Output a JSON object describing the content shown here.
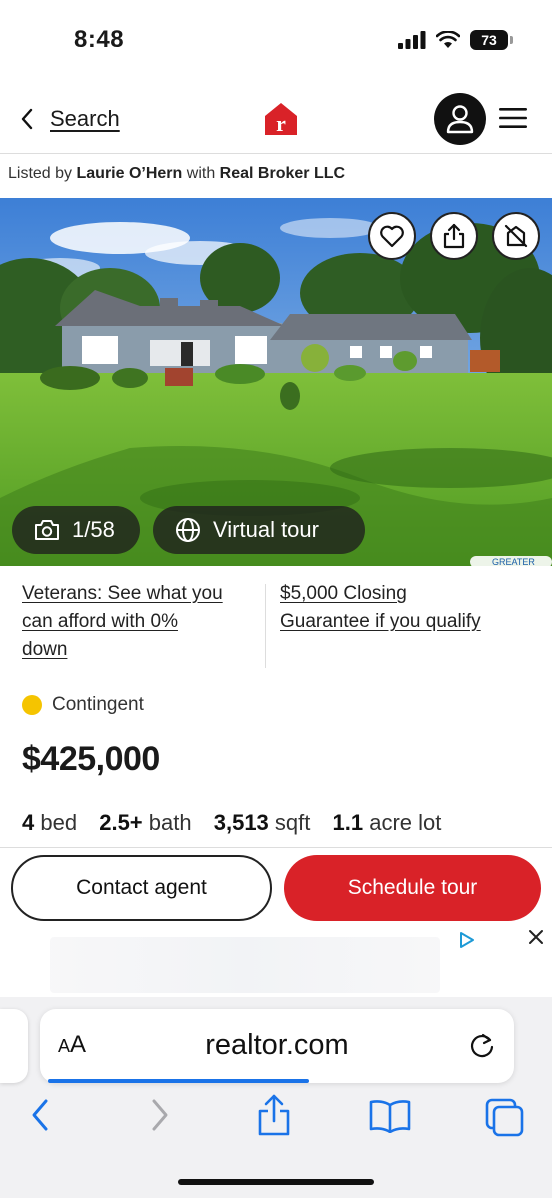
{
  "status_bar": {
    "time": "8:48",
    "battery": "73"
  },
  "header": {
    "back_label": "Search",
    "logo_letter": "r"
  },
  "listing": {
    "listed_by_prefix": "Listed by",
    "agent": "Laurie O’Hern",
    "with": "with",
    "broker": "Real Broker LLC"
  },
  "photo": {
    "counter": "1/58",
    "virtual_tour": "Virtual tour",
    "watermark": "GREATER"
  },
  "promos": [
    {
      "line1": "Veterans: See what you",
      "line2": "can afford with 0%",
      "line3": "down"
    },
    {
      "line1": "$5,000 Closing",
      "line2": "Guarantee if you qualify"
    }
  ],
  "property": {
    "status": "Contingent",
    "price": "$425,000",
    "beds": "4",
    "beds_unit": "bed",
    "baths": "2.5+",
    "baths_unit": "bath",
    "sqft": "3,513",
    "sqft_unit": "sqft",
    "lot": "1.1",
    "lot_unit": "acre lot"
  },
  "actions": {
    "contact": "Contact agent",
    "schedule": "Schedule tour"
  },
  "browser": {
    "aa_small": "A",
    "aa_big": "A",
    "url": "realtor.com",
    "load_progress": 0.55
  },
  "colors": {
    "brand_red": "#d92228",
    "status_yellow": "#f5c400",
    "link_blue": "#1a73e8"
  }
}
